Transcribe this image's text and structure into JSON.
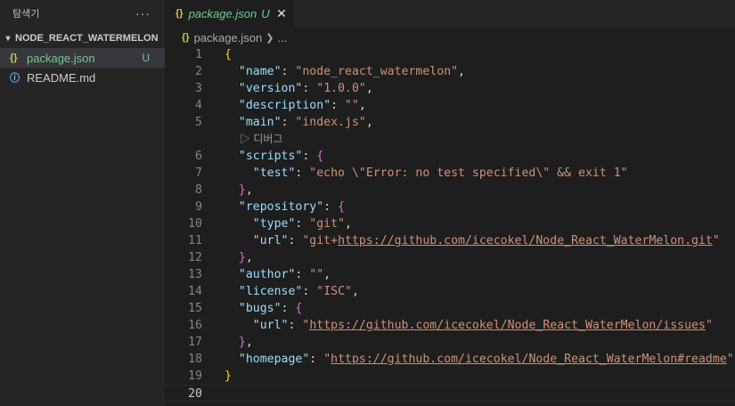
{
  "sidebar": {
    "title": "탐색기",
    "more_icon": "ellipsis-icon",
    "folder": "NODE_REACT_WATERMELON",
    "files": [
      {
        "name": "package.json",
        "icon": "json-icon",
        "badge": "U",
        "active": true
      },
      {
        "name": "README.md",
        "icon": "info-icon",
        "badge": "",
        "active": false
      }
    ]
  },
  "tab": {
    "icon_text": "{}",
    "name": "package.json",
    "badge": "U",
    "close": "✕"
  },
  "breadcrumb": {
    "icon_text": "{}",
    "file": "package.json",
    "sep": "❯",
    "more": "..."
  },
  "codelens": {
    "label": "디버그",
    "icon": "play-icon"
  },
  "code": {
    "line_numbers": [
      "1",
      "2",
      "3",
      "4",
      "5",
      "6",
      "7",
      "8",
      "9",
      "10",
      "11",
      "12",
      "13",
      "14",
      "15",
      "16",
      "17",
      "18",
      "19",
      "20"
    ],
    "l1": "{",
    "l2k": "\"name\"",
    "l2v": "\"node_react_watermelon\"",
    "l3k": "\"version\"",
    "l3v": "\"1.0.0\"",
    "l4k": "\"description\"",
    "l4v": "\"\"",
    "l5k": "\"main\"",
    "l5v": "\"index.js\"",
    "l6k": "\"scripts\"",
    "l6b": "{",
    "l7k": "\"test\"",
    "l7v": "\"echo \\\"Error: no test specified\\\" && exit 1\"",
    "l8b": "}",
    "l9k": "\"repository\"",
    "l9b": "{",
    "l10k": "\"type\"",
    "l10v": "\"git\"",
    "l11k": "\"url\"",
    "l11v_pre": "\"git+",
    "l11v_link": "https://github.com/icecokel/Node_React_WaterMelon.git",
    "l11v_post": "\"",
    "l12b": "}",
    "l13k": "\"author\"",
    "l13v": "\"\"",
    "l14k": "\"license\"",
    "l14v": "\"ISC\"",
    "l15k": "\"bugs\"",
    "l15b": "{",
    "l16k": "\"url\"",
    "l16v_pre": "\"",
    "l16v_link": "https://github.com/icecokel/Node_React_WaterMelon/issues",
    "l16v_post": "\"",
    "l17b": "}",
    "l18k": "\"homepage\"",
    "l18v_pre": "\"",
    "l18v_link": "https://github.com/icecokel/Node_React_WaterMelon#readme",
    "l18v_post": "\"",
    "l19": "}"
  },
  "colors": {
    "key": "#9cdcfe",
    "string": "#ce9178",
    "bracket1": "#ffd700",
    "bracket2": "#da70d6",
    "git_untracked": "#73c991"
  }
}
